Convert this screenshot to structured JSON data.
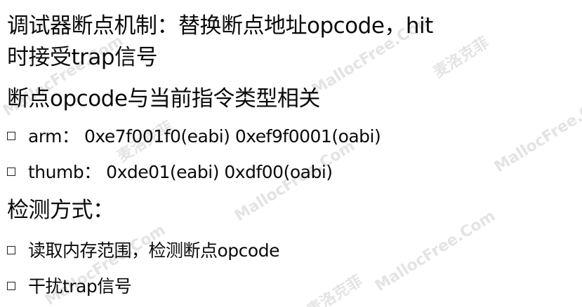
{
  "slide": {
    "lines": [
      "调试器断点机制：替换断点地址opcode，hit",
      "时接受trap信号",
      "断点opcode与当前指令类型相关",
      "arm：  0xe7f001f0(eabi) 0xef9f0001(oabi)",
      "thumb：  0xde01(eabi) 0xdf00(oabi)",
      "检测方式：",
      "读取内存范围，检测断点opcode",
      "干扰trap信号"
    ]
  },
  "watermark": {
    "text": "MallocFree.Com",
    "text_cn": "麦洛克菲"
  }
}
